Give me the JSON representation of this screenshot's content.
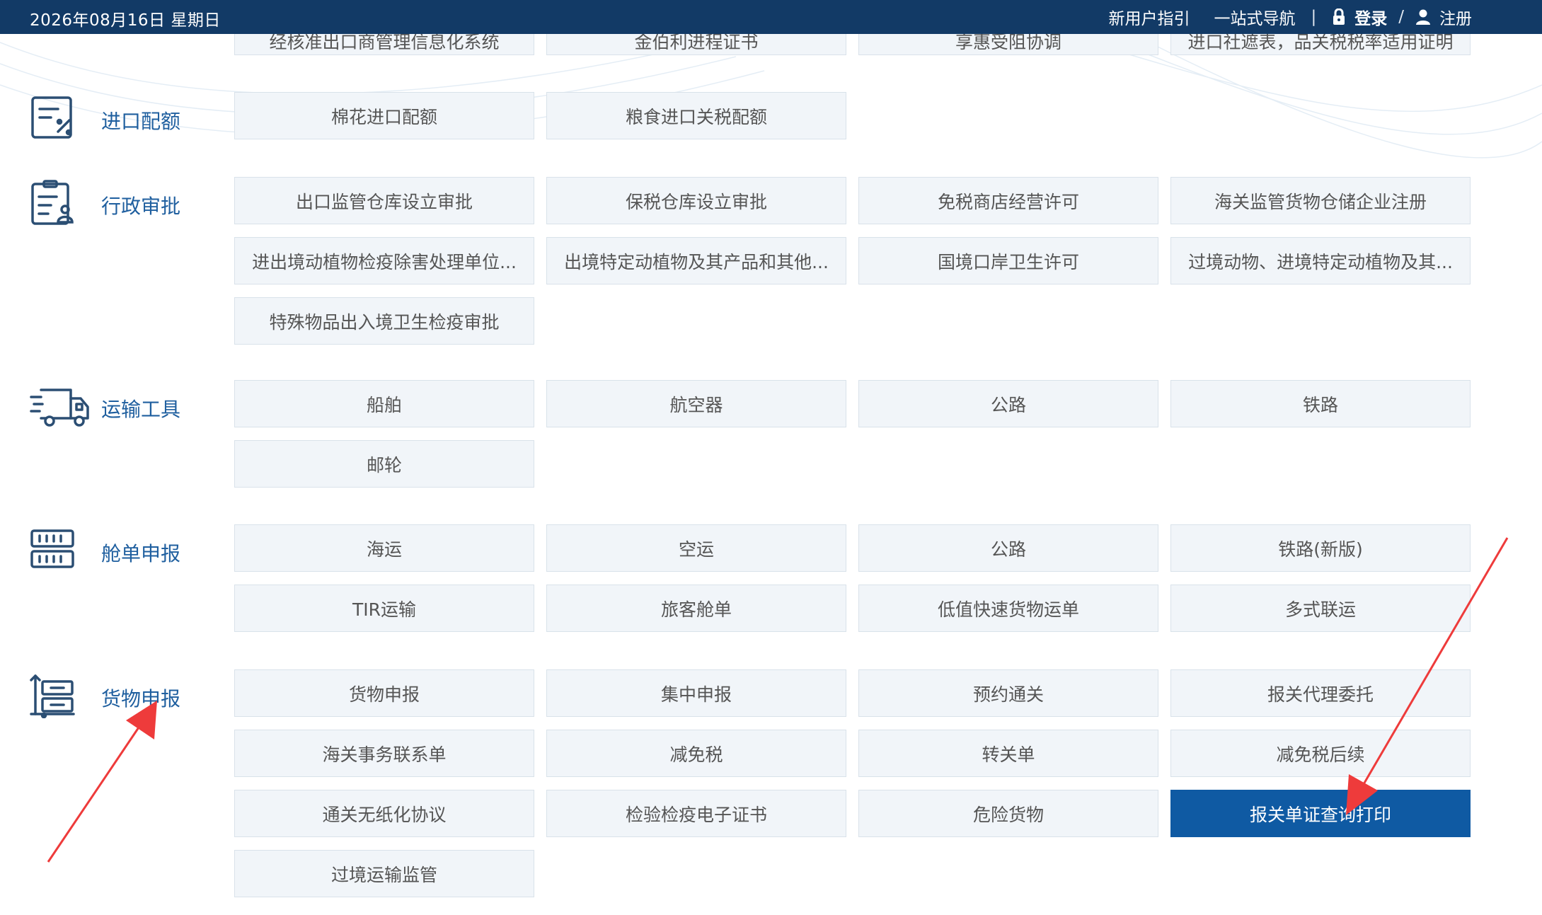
{
  "header": {
    "date": "2026年08月16日 星期日",
    "new_user_guide": "新用户指引",
    "one_stop_nav": "一站式导航",
    "separator": "|",
    "login": "登录",
    "slash": "/",
    "register": "注册",
    "lock_icon": "lock-icon",
    "user_icon": "user-icon"
  },
  "top_partial_row": [
    "经核准出口商管理信息化系统",
    "金伯利进程证书",
    "享惠受阻协调",
    "进口社遮表，品关税税率适用证明"
  ],
  "sections": [
    {
      "title": "进口配额",
      "icon": "quota-form-icon",
      "items": [
        "棉花进口配额",
        "粮食进口关税配额"
      ]
    },
    {
      "title": "行政审批",
      "icon": "approval-document-icon",
      "items": [
        "出口监管仓库设立审批",
        "保税仓库设立审批",
        "免税商店经营许可",
        "海关监管货物仓储企业注册",
        "进出境动植物检疫除害处理单位...",
        "出境特定动植物及其产品和其他...",
        "国境口岸卫生许可",
        "过境动物、进境特定动植物及其...",
        "特殊物品出入境卫生检疫审批"
      ]
    },
    {
      "title": "运输工具",
      "icon": "truck-icon",
      "items": [
        "船舶",
        "航空器",
        "公路",
        "铁路",
        "邮轮"
      ]
    },
    {
      "title": "舱单申报",
      "icon": "manifest-icon",
      "items": [
        "海运",
        "空运",
        "公路",
        "铁路(新版)",
        "TIR运输",
        "旅客舱单",
        "低值快速货物运单",
        "多式联运"
      ]
    },
    {
      "title": "货物申报",
      "icon": "cargo-declaration-icon",
      "items": [
        "货物申报",
        "集中申报",
        "预约通关",
        "报关代理委托",
        "海关事务联系单",
        "减免税",
        "转关单",
        "减免税后续",
        "通关无纸化协议",
        "检验检疫电子证书",
        "危险货物",
        "报关单证查询打印",
        "过境运输监管"
      ],
      "active_item": "报关单证查询打印"
    }
  ],
  "colors": {
    "topbar": "#123a66",
    "section_title": "#1f5f9f",
    "tile_bg": "#f1f5f9",
    "tile_active": "#0f5aa3",
    "annotation_arrow": "#ee3b3b"
  }
}
